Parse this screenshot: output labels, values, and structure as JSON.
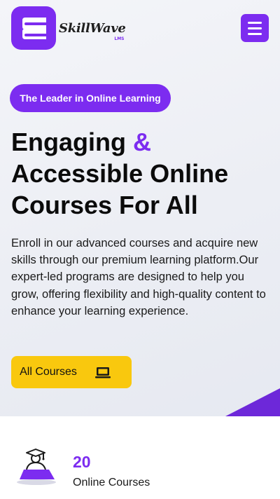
{
  "header": {
    "logo_name": "SkillWave",
    "logo_sub": "LMS",
    "menu_icon": "hamburger-menu-icon"
  },
  "hero": {
    "tagline": "The Leader in Online Learning",
    "headline_part1": "Engaging ",
    "headline_amp": "&",
    "headline_part2": "Accessible Online Courses For All",
    "description": "Enroll in our advanced courses and acquire new skills through our premium learning platform.Our expert-led programs are designed to help you grow, offering flexibility and high-quality content to enhance your learning experience.",
    "cta_label": "All Courses",
    "cta_icon": "laptop-icon"
  },
  "stats": [
    {
      "number": "20",
      "label": "Online Courses",
      "icon": "graduate-student-icon"
    }
  ],
  "colors": {
    "accent": "#7c2cf0",
    "cta": "#f9c80e"
  }
}
